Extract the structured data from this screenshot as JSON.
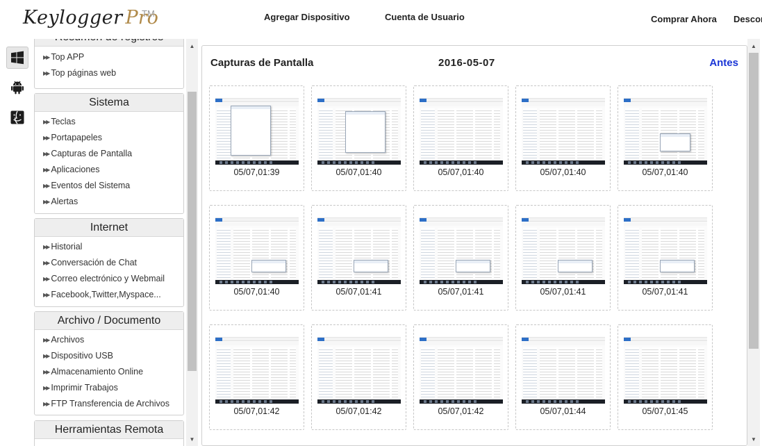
{
  "header": {
    "logo_main": "Keylogger",
    "logo_pro": "Pro",
    "logo_tm": "TM",
    "nav": {
      "add_device": "Agregar Dispositivo",
      "user_account": "Cuenta de Usuario",
      "buy_now": "Comprar Ahora",
      "download_partial": "Descor"
    }
  },
  "os_icons": [
    "windows-icon",
    "android-icon",
    "mac-icon"
  ],
  "sidebar": {
    "summary": {
      "title": "Resumen de registros",
      "items": [
        "Top APP",
        "Top páginas web"
      ]
    },
    "sistema": {
      "title": "Sistema",
      "items": [
        "Teclas",
        "Portapapeles",
        "Capturas de Pantalla",
        "Aplicaciones",
        "Eventos del Sistema",
        "Alertas"
      ]
    },
    "internet": {
      "title": "Internet",
      "items": [
        "Historial",
        "Conversación de Chat",
        "Correo electrónico y Webmail",
        "Facebook,Twitter,Myspace..."
      ]
    },
    "archivo": {
      "title": "Archivo / Documento",
      "items": [
        "Archivos",
        "Dispositivo USB",
        "Almacenamiento Online",
        "Imprimir Trabajos",
        "FTP Transferencia de Archivos"
      ]
    },
    "remote": {
      "title": "Herramientas Remota"
    }
  },
  "main": {
    "title": "Capturas de Pantalla",
    "date": "2016-05-07",
    "prev_label": "Antes",
    "screenshots": [
      "05/07,01:39",
      "05/07,01:40",
      "05/07,01:40",
      "05/07,01:40",
      "05/07,01:40",
      "05/07,01:40",
      "05/07,01:41",
      "05/07,01:41",
      "05/07,01:41",
      "05/07,01:41",
      "05/07,01:42",
      "05/07,01:42",
      "05/07,01:42",
      "05/07,01:44",
      "05/07,01:45"
    ]
  },
  "colors": {
    "accent_link": "#1a35d6",
    "logo_pro": "#b08a4a",
    "panel_header_bg": "#eeeeee"
  }
}
